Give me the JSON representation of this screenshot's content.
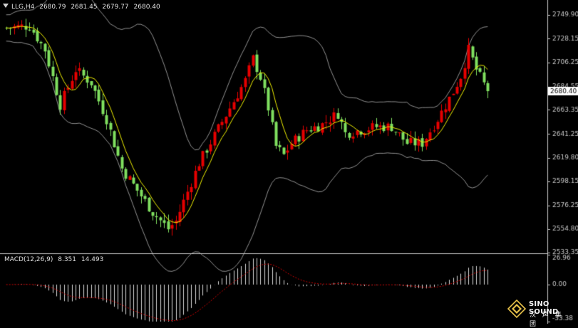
{
  "header": {
    "symbol": "LLG,H4",
    "open": "2680.79",
    "high": "2681.45",
    "low": "2679.77",
    "close": "2680.40"
  },
  "macd_header": {
    "label": "MACD(12,26,9)",
    "main": "8.351",
    "signal": "14.493"
  },
  "brand": {
    "name": "SINO SOUND",
    "subtitle": "汉 声 集 团"
  },
  "colors": {
    "background": "#000000",
    "bull": "#e60000",
    "bear": "#7fdf5f",
    "ma": "#f0f000",
    "bands": "#b8b8b8",
    "axis": "#c8c8c8",
    "macd_hist": "#d8d8d8",
    "macd_signal": "#d40000"
  },
  "chart_data": [
    {
      "type": "candlestick",
      "title": "LLG,H4",
      "ylim": [
        2533.35,
        2753.0
      ],
      "y_ticks": [
        2749.9,
        2728.15,
        2706.25,
        2684.55,
        2663.35,
        2641.25,
        2619.8,
        2598.15,
        2576.25,
        2554.8,
        2533.35
      ],
      "current_price": 2680.4,
      "overlays": [
        "moving-average",
        "bollinger-bands"
      ],
      "path_knots": [
        [
          0,
          2738
        ],
        [
          6,
          2740
        ],
        [
          10,
          2718
        ],
        [
          14,
          2668
        ],
        [
          18,
          2700
        ],
        [
          22,
          2688
        ],
        [
          26,
          2655
        ],
        [
          30,
          2610
        ],
        [
          34,
          2590
        ],
        [
          38,
          2570
        ],
        [
          42,
          2555
        ],
        [
          44,
          2562
        ],
        [
          46,
          2580
        ],
        [
          50,
          2615
        ],
        [
          54,
          2640
        ],
        [
          58,
          2665
        ],
        [
          62,
          2690
        ],
        [
          64,
          2710
        ],
        [
          66,
          2693
        ],
        [
          68,
          2665
        ],
        [
          70,
          2630
        ],
        [
          72,
          2622
        ],
        [
          74,
          2633
        ],
        [
          78,
          2645
        ],
        [
          82,
          2650
        ],
        [
          86,
          2660
        ],
        [
          88,
          2642
        ],
        [
          92,
          2645
        ],
        [
          96,
          2648
        ],
        [
          100,
          2648
        ],
        [
          104,
          2633
        ],
        [
          108,
          2633
        ],
        [
          112,
          2655
        ],
        [
          116,
          2680
        ],
        [
          118,
          2694
        ],
        [
          120,
          2718
        ],
        [
          122,
          2700
        ],
        [
          125,
          2680
        ]
      ]
    },
    {
      "type": "macd",
      "title": "MACD(12,26,9)",
      "ylim": [
        -33.38,
        26.96
      ],
      "y_ticks": [
        26.96,
        0.0,
        -33.38
      ],
      "main_value": 8.351,
      "signal_value": 14.493
    }
  ]
}
